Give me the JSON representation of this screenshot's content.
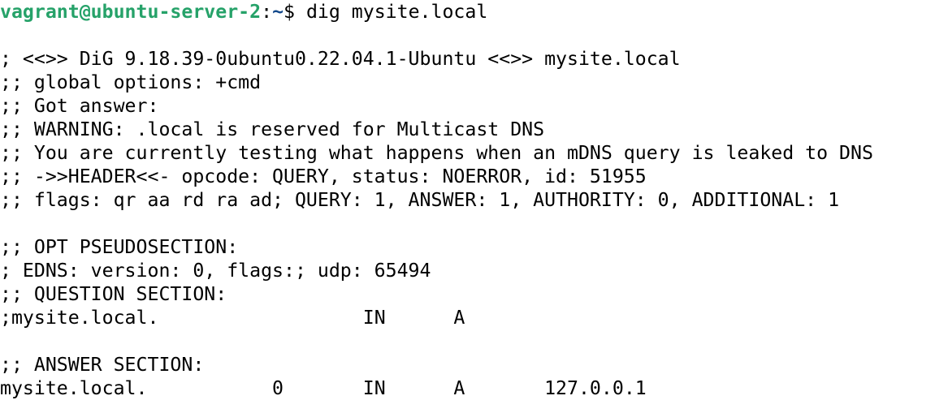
{
  "prompt": {
    "user_host": "vagrant@ubuntu-server-2",
    "separator": ":",
    "path": "~",
    "symbol": "$ ",
    "command": "dig mysite.local",
    "colors": {
      "user_host": "#26a269",
      "path": "#12488b"
    }
  },
  "output_lines": [
    "",
    "; <<>> DiG 9.18.39-0ubuntu0.22.04.1-Ubuntu <<>> mysite.local",
    ";; global options: +cmd",
    ";; Got answer:",
    ";; WARNING: .local is reserved for Multicast DNS",
    ";; You are currently testing what happens when an mDNS query is leaked to DNS",
    ";; ->>HEADER<<- opcode: QUERY, status: NOERROR, id: 51955",
    ";; flags: qr aa rd ra ad; QUERY: 1, ANSWER: 1, AUTHORITY: 0, ADDITIONAL: 1",
    "",
    ";; OPT PSEUDOSECTION:",
    "; EDNS: version: 0, flags:; udp: 65494",
    ";; QUESTION SECTION:",
    ";mysite.local.\t\t\tIN\tA",
    "",
    ";; ANSWER SECTION:",
    "mysite.local.\t\t0\tIN\tA\t127.0.0.1"
  ]
}
